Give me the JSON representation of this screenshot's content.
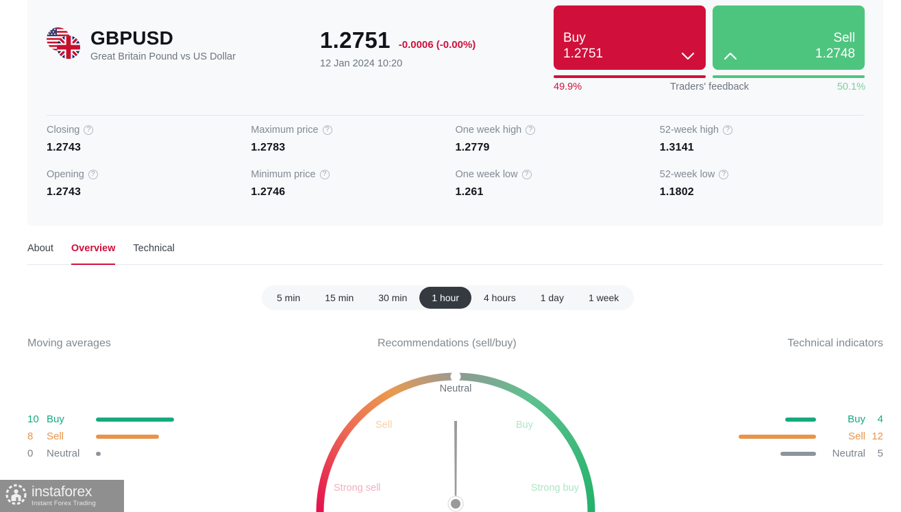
{
  "instrument": {
    "symbol": "GBPUSD",
    "description": "Great Britain Pound vs US Dollar",
    "price": "1.2751",
    "change": "-0.0006 (-0.00%)",
    "timestamp": "12 Jan 2024 10:20",
    "flag_left": "us-flag-icon",
    "flag_right": "gb-flag-icon"
  },
  "trade": {
    "buy_label": "Buy",
    "buy_price": "1.2751",
    "sell_label": "Sell",
    "sell_price": "1.2748",
    "buy_icon": "chevron-down-icon",
    "sell_icon": "chevron-up-icon",
    "feedback_title": "Traders' feedback",
    "feedback_buy_pct": "49.9%",
    "feedback_sell_pct": "50.1%",
    "buy_color": "#d0103a",
    "sell_color": "#4ec57f"
  },
  "stats": [
    {
      "label": "Closing",
      "value": "1.2743"
    },
    {
      "label": "Maximum price",
      "value": "1.2783"
    },
    {
      "label": "One week high",
      "value": "1.2779"
    },
    {
      "label": "52-week high",
      "value": "1.3141"
    },
    {
      "label": "Opening",
      "value": "1.2743"
    },
    {
      "label": "Minimum price",
      "value": "1.2746"
    },
    {
      "label": "One week low",
      "value": "1.261"
    },
    {
      "label": "52-week low",
      "value": "1.1802"
    }
  ],
  "tabs": [
    {
      "label": "About",
      "active": false
    },
    {
      "label": "Overview",
      "active": true
    },
    {
      "label": "Technical",
      "active": false
    }
  ],
  "periods": [
    {
      "label": "5 min",
      "active": false
    },
    {
      "label": "15 min",
      "active": false
    },
    {
      "label": "30 min",
      "active": false
    },
    {
      "label": "1 hour",
      "active": true
    },
    {
      "label": "4 hours",
      "active": false
    },
    {
      "label": "1 day",
      "active": false
    },
    {
      "label": "1 week",
      "active": false
    }
  ],
  "analysis": {
    "moving_averages_title": "Moving averages",
    "recommendations_title": "Recommendations (sell/buy)",
    "technical_indicators_title": "Technical indicators",
    "gauge_labels": {
      "neutral": "Neutral",
      "sell": "Sell",
      "buy": "Buy",
      "strong_sell": "Strong sell",
      "strong_buy": "Strong buy"
    },
    "gauge_needle_angle_deg": 0,
    "gauge_reading": "Neutral"
  },
  "chart_data": [
    {
      "type": "bar",
      "title": "Moving averages",
      "categories": [
        "Buy",
        "Sell",
        "Neutral"
      ],
      "values": [
        10,
        8,
        0
      ],
      "colors": [
        "#16a97f",
        "#e8944a",
        "#8d949b"
      ],
      "orientation": "horizontal",
      "max": 10
    },
    {
      "type": "bar",
      "title": "Technical indicators",
      "categories": [
        "Buy",
        "Sell",
        "Neutral"
      ],
      "values": [
        4,
        12,
        5
      ],
      "colors": [
        "#16a97f",
        "#e8944a",
        "#8d949b"
      ],
      "orientation": "horizontal-rtl",
      "max": 12
    },
    {
      "type": "gauge",
      "title": "Recommendations (sell/buy)",
      "zones": [
        "Strong sell",
        "Sell",
        "Neutral",
        "Buy",
        "Strong buy"
      ],
      "value": "Neutral",
      "needle_position": 0.5,
      "range": [
        0,
        1
      ]
    }
  ],
  "watermark": {
    "brand": "instaforex",
    "tagline": "Instant Forex Trading"
  }
}
